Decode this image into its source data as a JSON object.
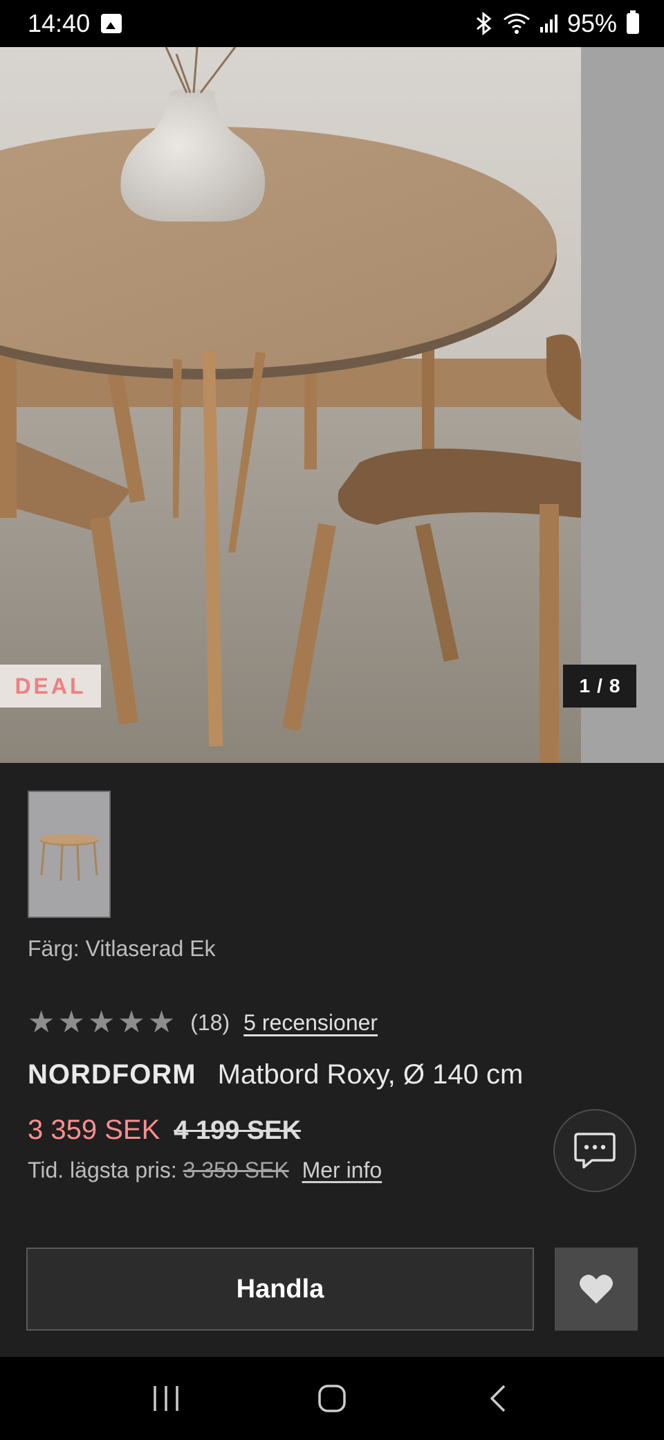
{
  "status_bar": {
    "time": "14:40",
    "battery": "95%"
  },
  "hero": {
    "badge": "DEAL",
    "counter_current": "1",
    "counter_sep": "/",
    "counter_total": "8"
  },
  "product": {
    "color_label": "Färg: Vitlaserad Ek",
    "rating_value": 5,
    "rating_count": "(18)",
    "reviews_link": "5 recensioner",
    "brand": "NORDFORM",
    "name": "Matbord Roxy, Ø 140 cm",
    "price_sale": "3 359 SEK",
    "price_old": "4 199 SEK",
    "lowest_prefix": "Tid. lägsta pris:",
    "lowest_price": "3 359 SEK",
    "more_info": "Mer info"
  },
  "actions": {
    "buy_label": "Handla"
  },
  "icons": {
    "gallery": "image-icon",
    "bluetooth": "bluetooth-icon",
    "wifi": "wifi-icon",
    "signal": "signal-icon",
    "battery": "battery-icon",
    "star": "star-icon",
    "chat": "chat-icon",
    "favorite": "heart-icon"
  },
  "colors": {
    "accent_sale": "#ff8e8e",
    "deal_badge_text": "#f07f7f",
    "background": "#1f1f1f"
  }
}
